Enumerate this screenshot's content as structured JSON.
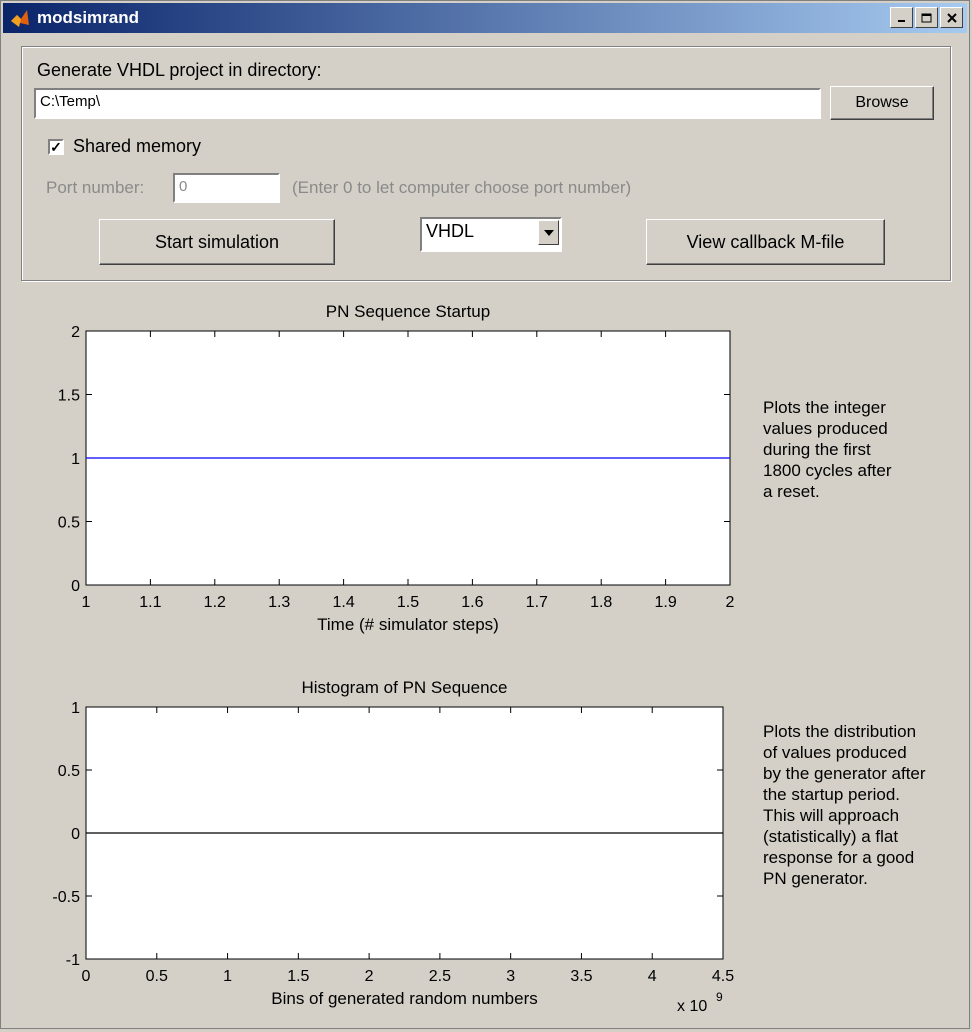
{
  "window": {
    "title": "modsimrand"
  },
  "panel": {
    "dir_label": "Generate VHDL project in directory:",
    "dir_value": "C:\\Temp\\",
    "browse_label": "Browse",
    "shared_memory_label": "Shared memory",
    "shared_memory_checked": true,
    "port_label": "Port number:",
    "port_value": "0",
    "port_hint": "(Enter 0 to let computer choose port number)",
    "start_label": "Start simulation",
    "language_selected": "VHDL",
    "view_callback_label": "View callback M-file"
  },
  "descriptions": {
    "startup": [
      "Plots the integer",
      "values produced",
      "during the first",
      "1800 cycles after",
      "a reset."
    ],
    "histogram": [
      "Plots the distribution",
      "of values produced",
      "by the generator after",
      "the startup period.",
      "This will approach",
      "(statistically) a flat",
      "response for a good",
      "PN generator."
    ]
  },
  "chart_data": [
    {
      "type": "line",
      "title": "PN Sequence Startup",
      "xlabel": "Time (# simulator steps)",
      "ylabel": "",
      "xlim": [
        1,
        2
      ],
      "ylim": [
        0,
        2
      ],
      "x_ticks": [
        "1",
        "1.1",
        "1.2",
        "1.3",
        "1.4",
        "1.5",
        "1.6",
        "1.7",
        "1.8",
        "1.9",
        "2"
      ],
      "y_ticks": [
        "0",
        "0.5",
        "1",
        "1.5",
        "2"
      ],
      "series": [
        {
          "x": [
            1,
            2
          ],
          "y": [
            1,
            1
          ],
          "color": "#0000ff"
        }
      ]
    },
    {
      "type": "line",
      "title": "Histogram of PN Sequence",
      "xlabel": "Bins of generated random numbers",
      "ylabel": "",
      "xlim": [
        0,
        4.5
      ],
      "ylim": [
        -1,
        1
      ],
      "x_ticks": [
        "0",
        "0.5",
        "1",
        "1.5",
        "2",
        "2.5",
        "3",
        "3.5",
        "4",
        "4.5"
      ],
      "y_ticks": [
        "-1",
        "-0.5",
        "0",
        "0.5",
        "1"
      ],
      "x_multiplier": "x 10",
      "x_multiplier_exp": "9",
      "series": [
        {
          "x": [
            0,
            4.5
          ],
          "y": [
            0,
            0
          ],
          "color": "#000000"
        }
      ]
    }
  ]
}
